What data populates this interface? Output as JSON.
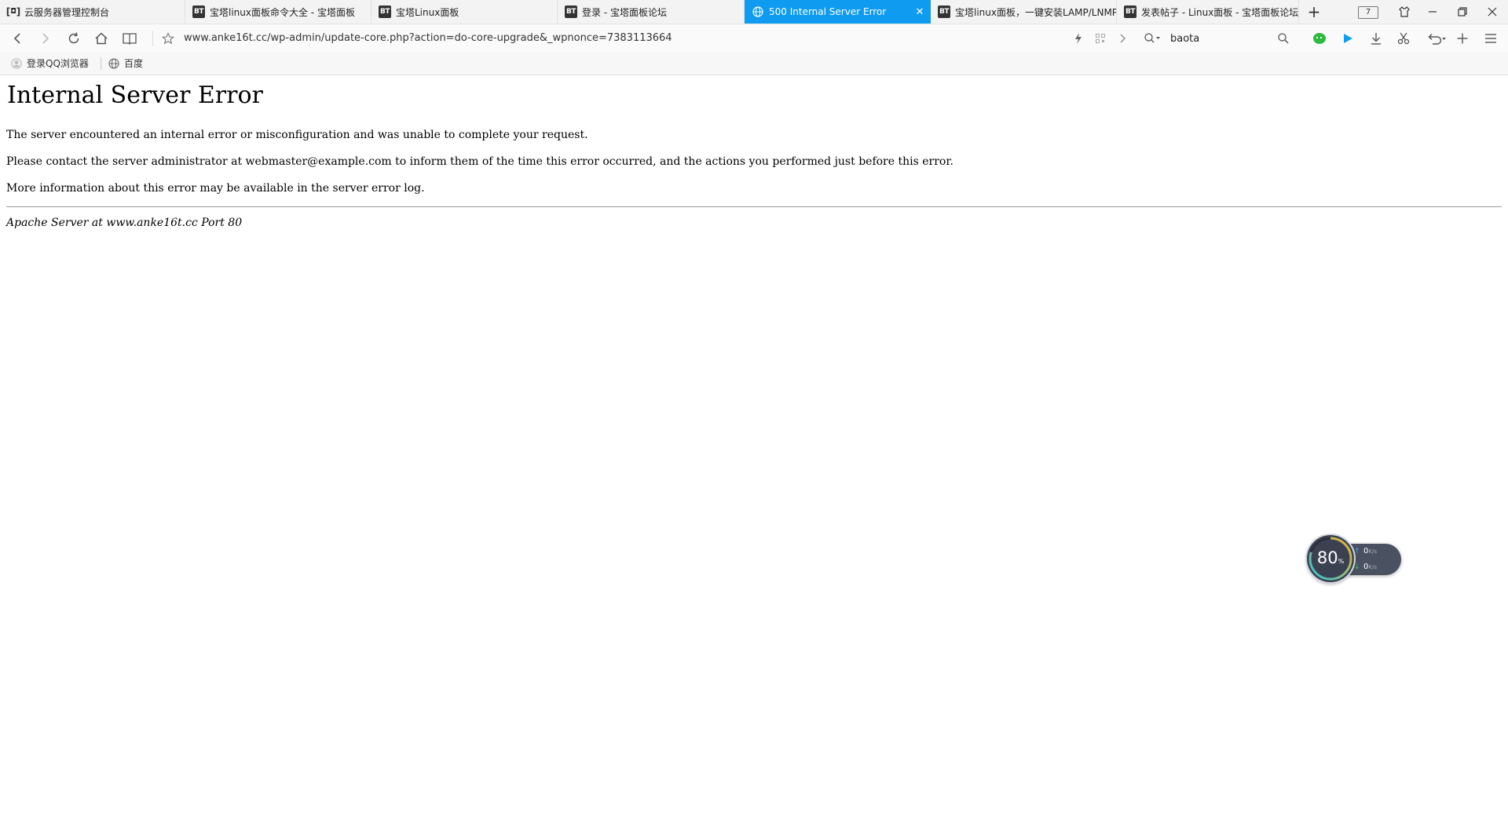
{
  "tabs": [
    {
      "title": "云服务器管理控制台",
      "favicon": "cloud-bracket-icon",
      "active": false
    },
    {
      "title": "宝塔linux面板命令大全 - 宝塔面板",
      "favicon": "bt-icon",
      "active": false
    },
    {
      "title": "宝塔Linux面板",
      "favicon": "bt-icon",
      "active": false
    },
    {
      "title": "登录 - 宝塔面板论坛",
      "favicon": "bt-icon",
      "active": false
    },
    {
      "title": "500 Internal Server Error",
      "favicon": "globe-icon",
      "active": true
    },
    {
      "title": "宝塔linux面板，一键安装LAMP/LNMP",
      "favicon": "bt-icon",
      "active": false
    },
    {
      "title": "发表帖子 - Linux面板 - 宝塔面板论坛",
      "favicon": "bt-icon",
      "active": false
    }
  ],
  "tab_count": "7",
  "address_bar": {
    "url": "www.anke16t.cc/wp-admin/update-core.php?action=do-core-upgrade&_wpnonce=7383113664"
  },
  "search": {
    "query": "baota"
  },
  "bookmarks": [
    {
      "label": "登录QQ浏览器",
      "icon": "user-avatar-icon"
    },
    {
      "label": "百度",
      "icon": "globe-icon"
    }
  ],
  "page": {
    "heading": "Internal Server Error",
    "paragraphs": [
      "The server encountered an internal error or misconfiguration and was unable to complete your request.",
      "Please contact the server administrator at webmaster@example.com to inform them of the time this error occurred, and the actions you performed just before this error.",
      "More information about this error may be available in the server error log."
    ],
    "address": "Apache Server at www.anke16t.cc Port 80"
  },
  "speed_widget": {
    "percent": "80",
    "percent_unit": "%",
    "upload": "0",
    "download": "0",
    "unit": "K/s",
    "usage_fraction": 0.8,
    "colors": {
      "ring_start": "#2ec4d6",
      "ring_end": "#f0b030",
      "up_arrow": "#3fa9f5",
      "down_arrow": "#3ecf6a"
    }
  },
  "colors": {
    "active_tab": "#0e9bf0",
    "wechat_green": "#2fb940",
    "play_blue": "#0e9bf0"
  }
}
